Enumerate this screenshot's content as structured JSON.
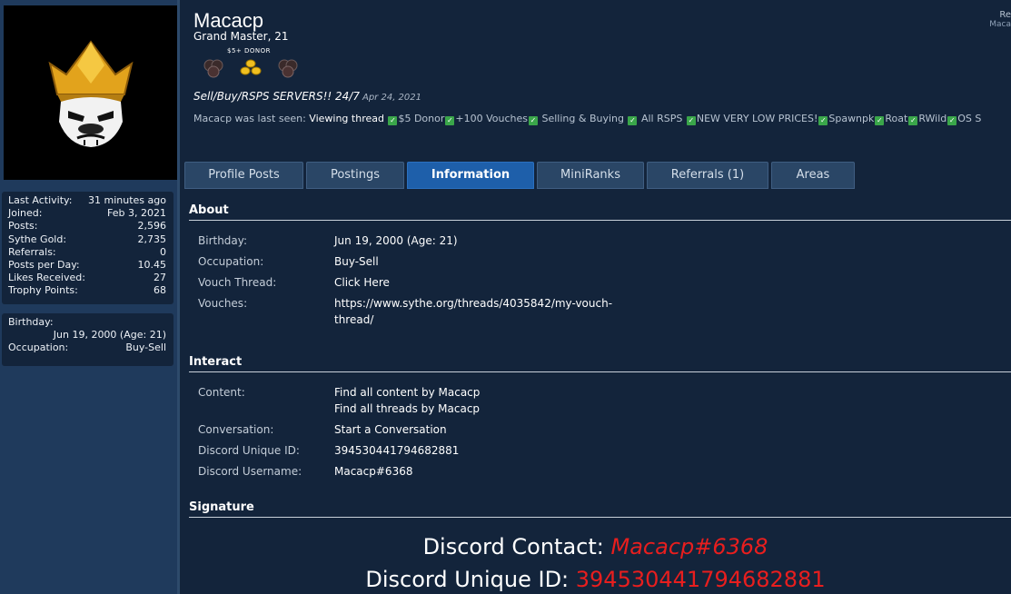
{
  "profile": {
    "username": "Macacp",
    "title": "Grand Master, 21",
    "donor_label": "$5+ DONOR",
    "status_text": "Sell/Buy/RSPS SERVERS!! 24/7",
    "status_date": "Apr 24, 2021",
    "last_seen_prefix": "Macacp was last seen:",
    "last_seen_activity": "Viewing thread",
    "last_seen_items": [
      "$5 Donor",
      "+100 Vouches",
      " Selling & Buying ",
      " All RSPS ",
      "NEW VERY LOW PRICES!",
      "Spawnpk",
      "Roat",
      "RWild",
      "OS S"
    ],
    "top_right_line1": "Re",
    "top_right_line2": "Maca"
  },
  "stats": [
    {
      "label": "Last Activity:",
      "value": "31 minutes ago"
    },
    {
      "label": "Joined:",
      "value": "Feb 3, 2021"
    },
    {
      "label": "Posts:",
      "value": "2,596"
    },
    {
      "label": "Sythe Gold:",
      "value": "2,735"
    },
    {
      "label": "Referrals:",
      "value": "0"
    },
    {
      "label": "Posts per Day:",
      "value": "10.45"
    },
    {
      "label": "Likes Received:",
      "value": "27"
    },
    {
      "label": "Trophy Points:",
      "value": "68"
    }
  ],
  "bio": {
    "birthday_label": "Birthday:",
    "birthday_value": "Jun 19, 2000 (Age: 21)",
    "occupation_label": "Occupation:",
    "occupation_value": "Buy-Sell"
  },
  "tabs": [
    "Profile Posts",
    "Postings",
    "Information",
    "MiniRanks",
    "Referrals (1)",
    "Areas"
  ],
  "about": {
    "title": "About",
    "birthday_label": "Birthday:",
    "birthday_value": "Jun 19, 2000 (Age: 21)",
    "occupation_label": "Occupation:",
    "occupation_value": "Buy-Sell",
    "vouch_label": "Vouch Thread:",
    "vouch_value": "Click Here",
    "vouches_label": "Vouches:",
    "vouches_line1": "https://www.sythe.org/threads/4035842/my-vouch-",
    "vouches_line2": "thread/"
  },
  "interact": {
    "title": "Interact",
    "content_label": "Content:",
    "content_link1": "Find all content by Macacp",
    "content_link2": "Find all threads by Macacp",
    "conversation_label": "Conversation:",
    "conversation_link": "Start a Conversation",
    "discord_id_label": "Discord Unique ID:",
    "discord_id_value": "394530441794682881",
    "discord_user_label": "Discord Username:",
    "discord_user_value": "Macacp#6368"
  },
  "signature": {
    "title": "Signature",
    "line1_label": "Discord Contact: ",
    "line1_value": "Macacp#6368",
    "line2_label": "Discord Unique ID: ",
    "line2_value": "394530441794682881"
  },
  "colors": {
    "background": "#2d4a6b",
    "panel": "#13243b",
    "active_tab": "#1e5faa",
    "signature_red": "#e81e1e",
    "check_green": "#3aa64a"
  }
}
